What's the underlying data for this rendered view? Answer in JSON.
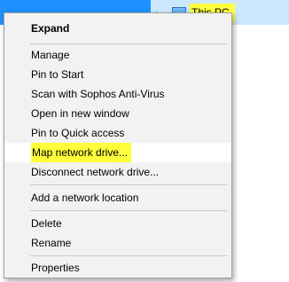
{
  "explorer": {
    "this_pc_label": "This PC",
    "highlight_color": "#ffff3b",
    "icon": "computer-icon"
  },
  "context_menu": {
    "items": [
      {
        "label": "Expand",
        "bold": true
      },
      {
        "label": "Manage"
      },
      {
        "label": "Pin to Start"
      },
      {
        "label": "Scan with Sophos Anti-Virus"
      },
      {
        "label": "Open in new window"
      },
      {
        "label": "Pin to Quick access"
      },
      {
        "label": "Map network drive...",
        "highlighted": true
      },
      {
        "label": "Disconnect network drive..."
      },
      {
        "label": "Add a network location"
      },
      {
        "label": "Delete"
      },
      {
        "label": "Rename"
      },
      {
        "label": "Properties"
      }
    ]
  }
}
